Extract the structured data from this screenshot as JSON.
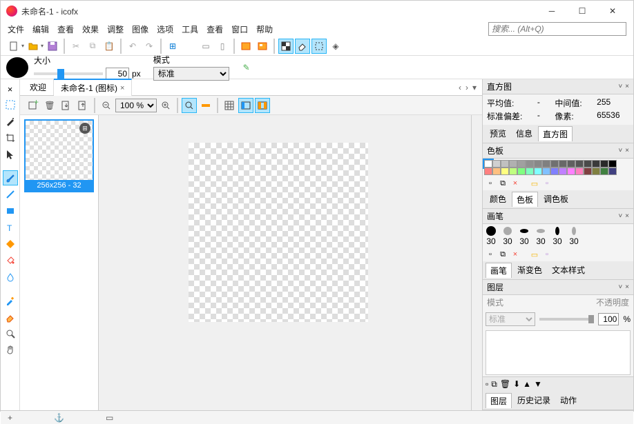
{
  "title": "未命名-1 - icofx",
  "menu": [
    "文件",
    "编辑",
    "查看",
    "效果",
    "调整",
    "图像",
    "选项",
    "工具",
    "查看",
    "窗口",
    "帮助"
  ],
  "search_placeholder": "搜索... (Alt+Q)",
  "size": {
    "label": "大小",
    "value": "50",
    "unit": "px"
  },
  "mode": {
    "label": "模式",
    "value": "标准"
  },
  "tabs": {
    "welcome": "欢迎",
    "doc": "未命名-1 (图标)"
  },
  "zoom": "100 %",
  "thumb": {
    "label": "256x256 - 32"
  },
  "panels": {
    "histogram": {
      "title": "直方图",
      "stats": {
        "avg_label": "平均值:",
        "avg": "-",
        "median_label": "中间值:",
        "median": "255",
        "std_label": "标准偏差:",
        "std": "-",
        "px_label": "像素:",
        "px": "65536"
      },
      "tabs": [
        "预览",
        "信息",
        "直方图"
      ]
    },
    "palette": {
      "title": "色板",
      "tabs": [
        "颜色",
        "色板",
        "调色板"
      ]
    },
    "brush": {
      "title": "画笔",
      "sizes": [
        "30",
        "30",
        "30",
        "30",
        "30",
        "30"
      ],
      "tabs": [
        "画笔",
        "渐变色",
        "文本样式"
      ]
    },
    "layer": {
      "title": "图层",
      "mode_label": "模式",
      "opacity_label": "不透明度",
      "mode": "标准",
      "opacity": "100",
      "pct": "%",
      "tabs": [
        "图层",
        "历史记录",
        "动作"
      ]
    }
  },
  "chart_data": {
    "type": "table",
    "title": "直方图统计",
    "rows": [
      {
        "label": "平均值",
        "value": "-"
      },
      {
        "label": "中间值",
        "value": 255
      },
      {
        "label": "标准偏差",
        "value": "-"
      },
      {
        "label": "像素",
        "value": 65536
      }
    ]
  },
  "palette_colors_row1": [
    "#ffffff",
    "#d0d0d0",
    "#c0c0c0",
    "#b0b0b0",
    "#a0a0a0",
    "#909090",
    "#888888",
    "#808080",
    "#707070",
    "#686868",
    "#606060",
    "#555555",
    "#4a4a4a",
    "#3a3a3a",
    "#2a2a2a",
    "#000000"
  ],
  "palette_colors_row2": [
    "#ff8080",
    "#ffc080",
    "#ffff80",
    "#c0ff80",
    "#80ff80",
    "#80ffc0",
    "#80ffff",
    "#80c0ff",
    "#8080ff",
    "#c080ff",
    "#ff80ff",
    "#ff80c0",
    "#804040",
    "#808040",
    "#408040",
    "#404080"
  ]
}
